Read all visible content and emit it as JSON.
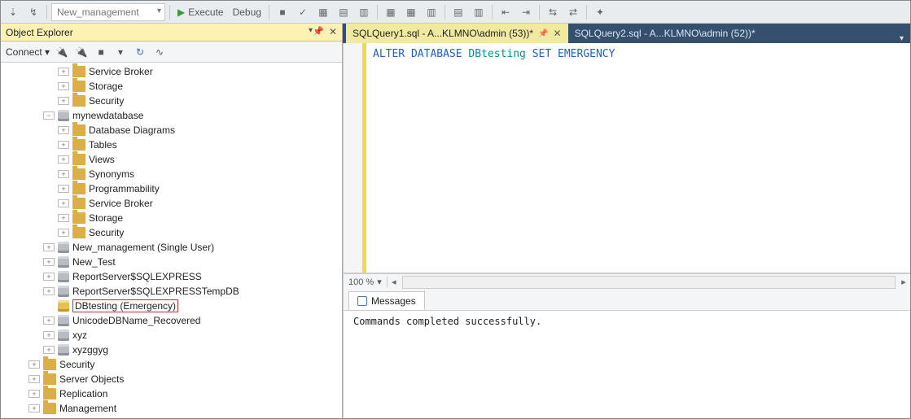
{
  "toolbar": {
    "db_selector": "New_management",
    "execute": "Execute",
    "debug": "Debug"
  },
  "explorer": {
    "title": "Object Explorer",
    "connect_label": "Connect"
  },
  "tree": {
    "n0": "Service Broker",
    "n1": "Storage",
    "n2": "Security",
    "n3": "mynewdatabase",
    "n4": "Database Diagrams",
    "n5": "Tables",
    "n6": "Views",
    "n7": "Synonyms",
    "n8": "Programmability",
    "n9": "Service Broker",
    "n10": "Storage",
    "n11": "Security",
    "n12": "New_management (Single User)",
    "n13": "New_Test",
    "n14": "ReportServer$SQLEXPRESS",
    "n15": "ReportServer$SQLEXPRESSTempDB",
    "n16": "DBtesting (Emergency)",
    "n17": "UnicodeDBName_Recovered",
    "n18": "xyz",
    "n19": "xyzggyg",
    "n20": "Security",
    "n21": "Server Objects",
    "n22": "Replication",
    "n23": "Management"
  },
  "tabs": {
    "t1": "SQLQuery1.sql - A...KLMNO\\admin (53))*",
    "t2": "SQLQuery2.sql - A...KLMNO\\admin (52))*"
  },
  "sql": {
    "kw1": "ALTER",
    "kw2": "DATABASE",
    "ident": "DBtesting",
    "kw3": "SET",
    "kw4": "EMERGENCY"
  },
  "zoom": "100 %",
  "messages": {
    "tab": "Messages",
    "text": "Commands completed successfully."
  }
}
